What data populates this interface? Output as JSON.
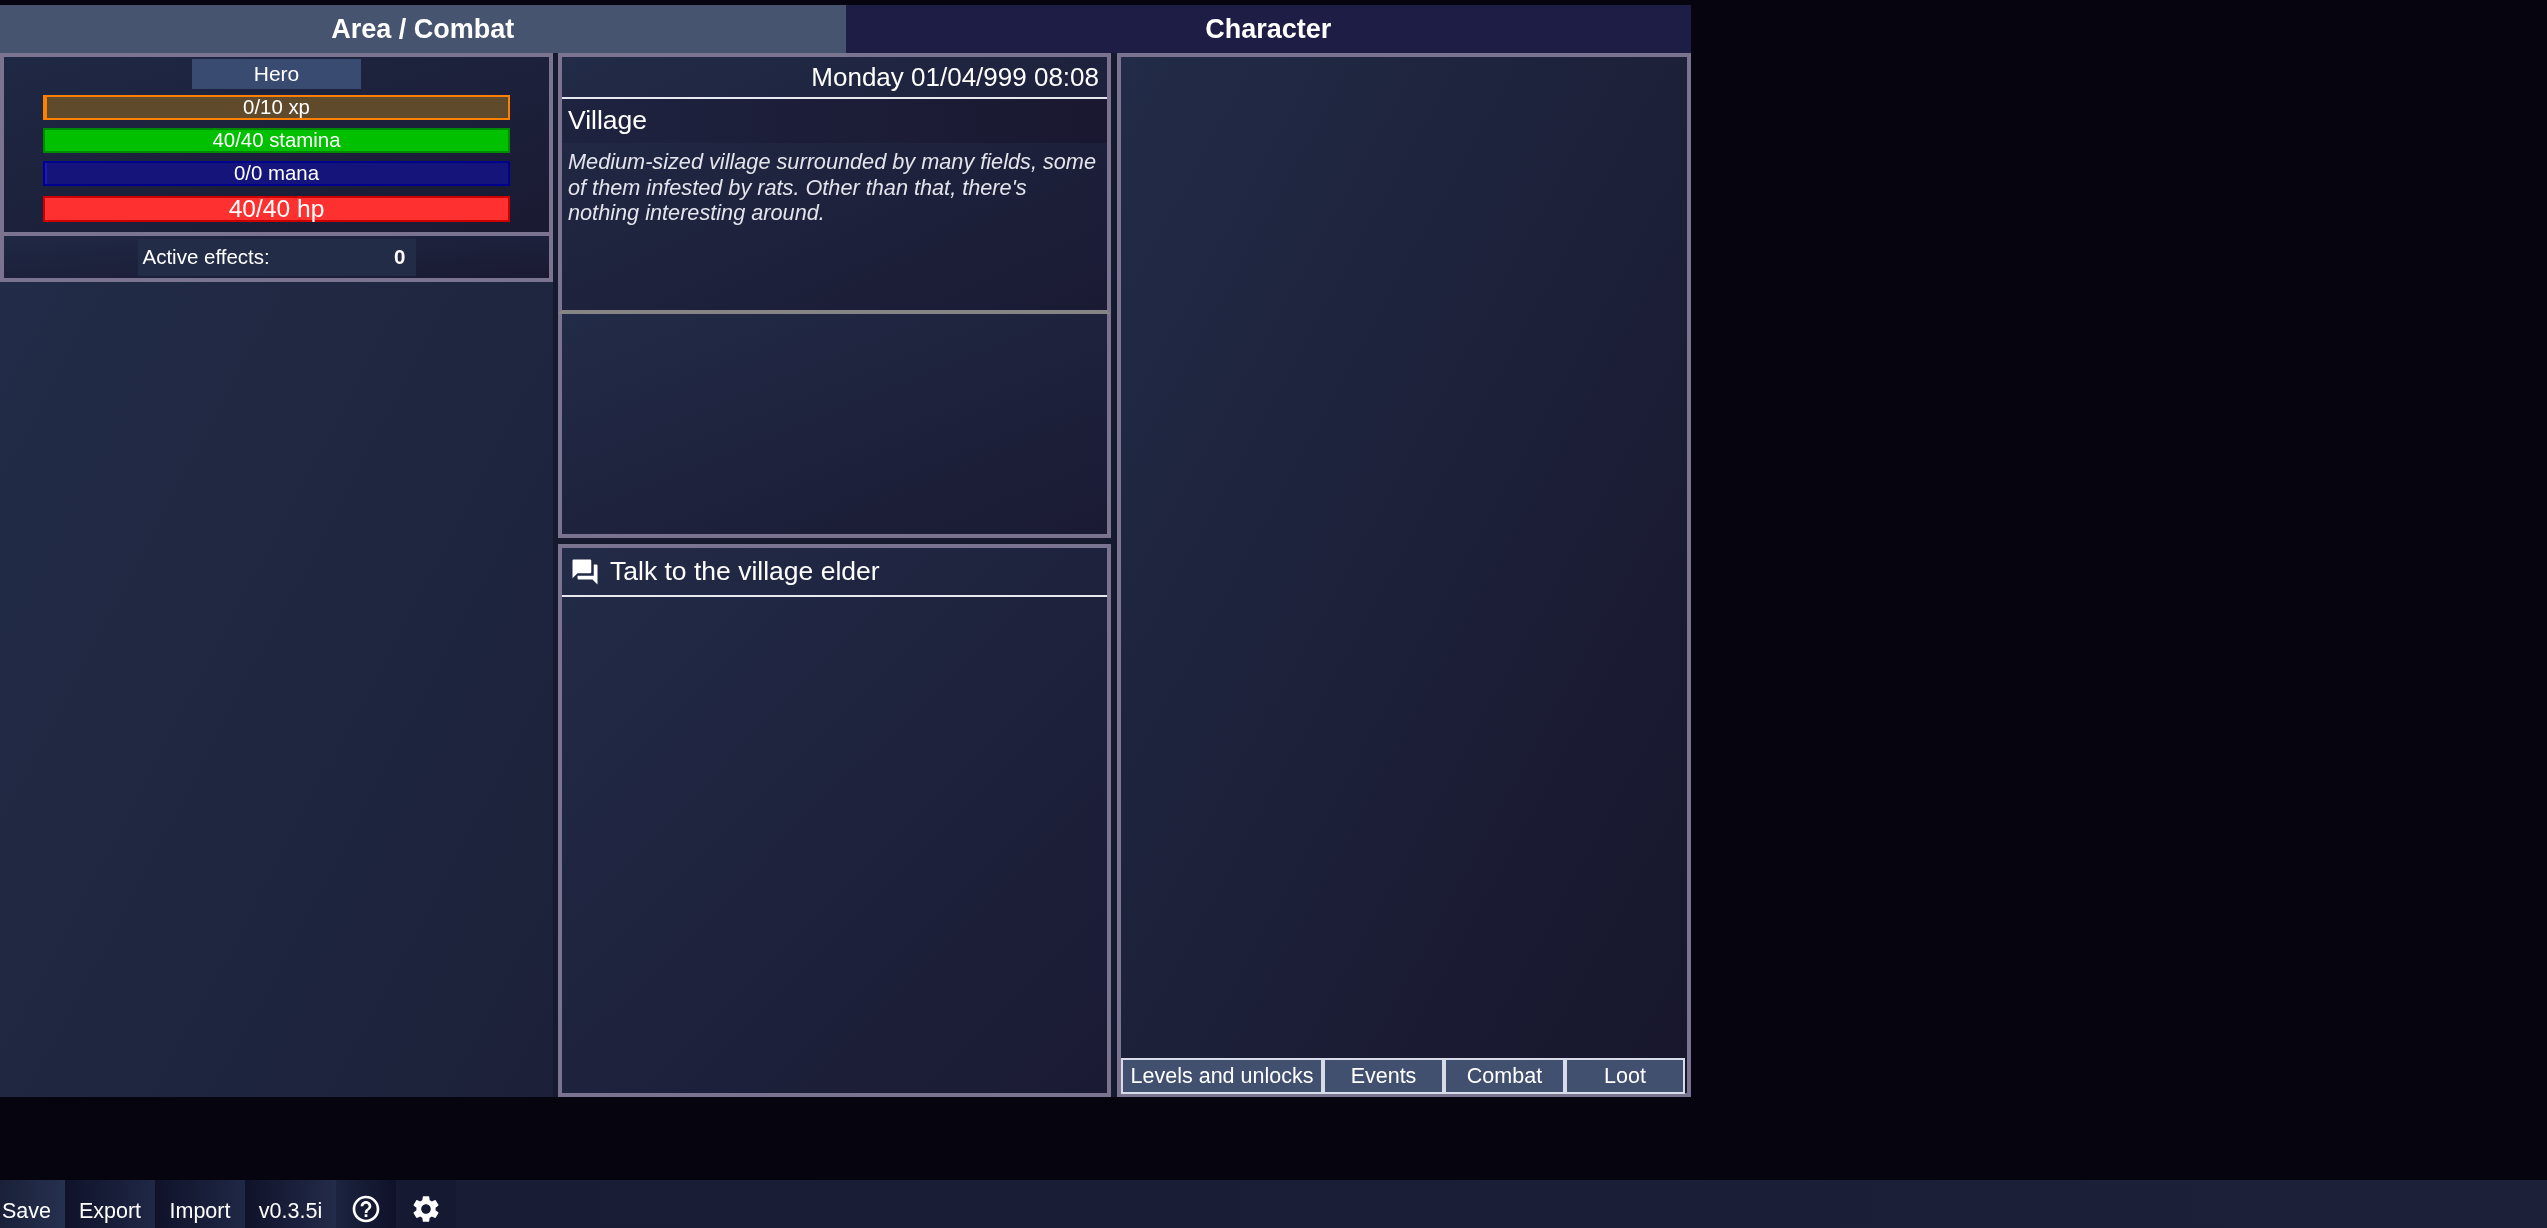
{
  "header_tabs": [
    {
      "label": "Area / Combat",
      "selected": true
    },
    {
      "label": "Character",
      "selected": false
    }
  ],
  "hero": {
    "name": "Hero",
    "bars": [
      {
        "kind": "xp",
        "text": "0/10 xp",
        "level": 0
      },
      {
        "kind": "stamina",
        "text": "40/40 stamina",
        "level": 1
      },
      {
        "kind": "mana",
        "text": "0/0 mana",
        "level": 0
      },
      {
        "kind": "hp",
        "text": "40/40 hp",
        "level": 1
      }
    ]
  },
  "active_effects": {
    "label": "Active effects:",
    "count": "0"
  },
  "location": {
    "datetime": "Monday 01/04/999 08:08",
    "name": "Village",
    "description": "Medium-sized village surrounded by many fields, some of them infested by rats. Other than that, there's nothing interesting around."
  },
  "action": {
    "label": "Talk to the village elder"
  },
  "character_tabs": [
    "Levels and unlocks",
    "Events",
    "Combat",
    "Loot"
  ],
  "bottom_bar": {
    "buttons": [
      "Save",
      "Export",
      "Import"
    ],
    "version": "v0.3.5i"
  }
}
